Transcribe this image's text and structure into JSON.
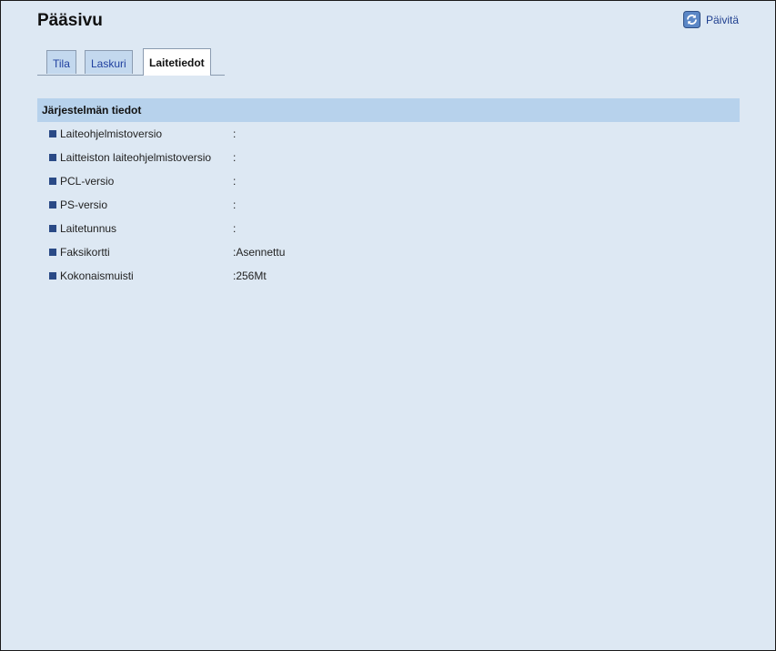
{
  "page": {
    "title": "Pääsivu",
    "refresh_label": "Päivitä"
  },
  "tabs": [
    {
      "label": "Tila",
      "active": false
    },
    {
      "label": "Laskuri",
      "active": false
    },
    {
      "label": "Laitetiedot",
      "active": true
    }
  ],
  "section": {
    "title": "Järjestelmän tiedot",
    "rows": [
      {
        "label": "Laiteohjelmistoversio",
        "value": ":"
      },
      {
        "label": "Laitteiston laiteohjelmistoversio",
        "value": ":"
      },
      {
        "label": "PCL-versio",
        "value": ":"
      },
      {
        "label": "PS-versio",
        "value": ":"
      },
      {
        "label": "Laitetunnus",
        "value": ":"
      },
      {
        "label": "Faksikortti",
        "value": ":Asennettu"
      },
      {
        "label": "Kokonaismuisti",
        "value": ":256Mt"
      }
    ]
  },
  "icons": {
    "refresh": "refresh-icon",
    "bullet": "square-bullet-icon"
  },
  "colors": {
    "background": "#dde8f3",
    "section_header": "#b7d2ec",
    "tab_inactive": "#c3d8ee",
    "link": "#1f3f8f",
    "bullet": "#2a4a86"
  }
}
